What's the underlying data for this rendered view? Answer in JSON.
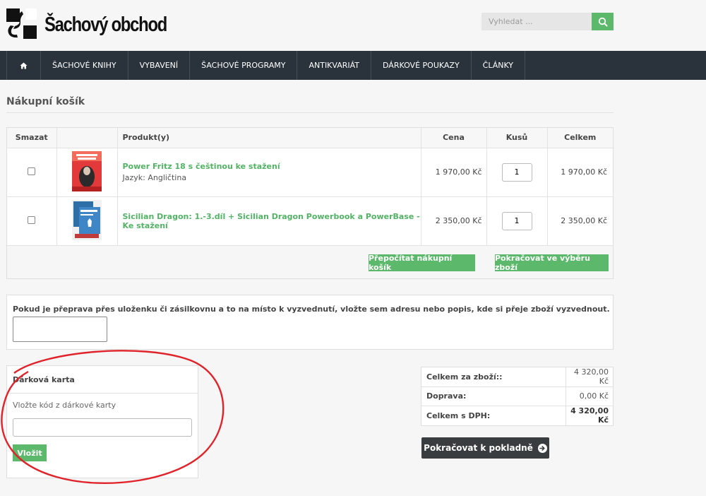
{
  "header": {
    "brand": "Šachový obchod",
    "search_placeholder": "Vyhledat ..."
  },
  "nav": {
    "items": [
      "ŠACHOVÉ KNIHY",
      "VYBAVENÍ",
      "ŠACHOVÉ PROGRAMY",
      "ANTIKVARIÁT",
      "DÁRKOVÉ POUKAZY",
      "ČLÁNKY"
    ]
  },
  "page": {
    "title": "Nákupní košík"
  },
  "cart": {
    "columns": {
      "delete": "Smazat",
      "product": "Produkt(y)",
      "price": "Cena",
      "qty": "Kusů",
      "total": "Celkem"
    },
    "rows": [
      {
        "name": "Power Fritz 18 s češtinou ke stažení",
        "meta": "Jazyk: Angličtina",
        "price": "1 970,00 Kč",
        "qty": "1",
        "total": "1 970,00 Kč"
      },
      {
        "name": "Sicilian Dragon: 1.-3.díl + Sicilian Dragon Powerbook a PowerBase - Ke stažení",
        "meta": "",
        "price": "2 350,00 Kč",
        "qty": "1",
        "total": "2 350,00 Kč"
      }
    ],
    "recalc_label": "Přepočítat nákupní košík",
    "continue_label": "Pokračovat ve výběru zboží"
  },
  "note": {
    "label": "Pokud je přeprava přes uloženku či zásilkovnu a to na místo k vyzvednutí, vložte sem adresu nebo popis, kde si přeje zboží vyzvednout."
  },
  "gift": {
    "title": "Dárková karta",
    "hint": "Vložte kód z dárkové karty",
    "button": "Vložit"
  },
  "totals": {
    "rows": [
      {
        "label": "Celkem za zboží::",
        "value": "4 320,00 Kč"
      },
      {
        "label": "Doprava:",
        "value": "0,00 Kč"
      },
      {
        "label": "Celkem s DPH:",
        "value": "4 320,00 Kč"
      }
    ]
  },
  "checkout": {
    "label": "Pokračovat k pokladně"
  },
  "colors": {
    "accent": "#5cb86a",
    "nav_bg": "#2a333c",
    "annotation": "#e0232a"
  }
}
